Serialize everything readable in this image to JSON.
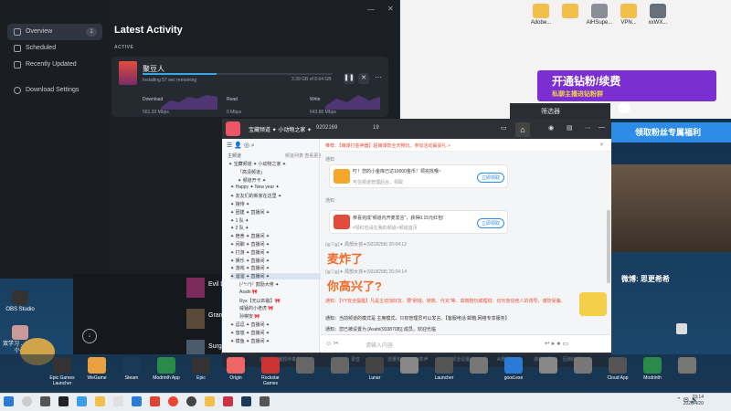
{
  "download_manager": {
    "sidebar": [
      {
        "label": "Overview",
        "badge": "1"
      },
      {
        "label": "Scheduled"
      },
      {
        "label": "Recently Updated"
      },
      {
        "label": "Download Settings"
      }
    ],
    "title": "Latest Activity",
    "section_label": "ACTIVE",
    "item": {
      "name": "聚豆人",
      "status": "Installing 57 sec remaining",
      "size": "3.39 GB of 8.64 GB",
      "progress": 0.39
    },
    "stats": [
      {
        "label": "Download",
        "value": "561.33 Mbps"
      },
      {
        "label": "Read",
        "value": "0 Mbps"
      },
      {
        "label": "Write",
        "value": "643.80 Mbps"
      }
    ],
    "sidebar_extra": [
      "Evil D",
      "Gran",
      "Surg"
    ]
  },
  "desktop": {
    "top_icons": [
      "Adobe...",
      "",
      "AlHSupe...",
      "VPN...",
      "xxWX..."
    ],
    "left_icons": [
      "OBS Studio",
      "双学习 ...MAN 小 ..."
    ],
    "clock_time": "23:14",
    "clock_date": "2026/4/20"
  },
  "dock": {
    "items": [
      "Epic Games Launcher",
      "WeGame",
      "Steam",
      "Modrinth App",
      "Epic",
      "Origin",
      "Rockstar Games",
      "",
      "",
      "Lunar",
      "",
      "Launcher",
      "",
      "good.exe",
      "",
      "",
      "Cloud App",
      "Modrinth",
      ""
    ]
  },
  "overlays": {
    "purple_title": "开通钻粉/续费",
    "purple_sub": "私聊主播进钻粉群",
    "blue_banner": "领取粉丝专属福利",
    "weibo": "微博: 思更希希",
    "dark_panel_label": "筛选器"
  },
  "chat": {
    "channel": "宝藏频道 ✦ 小动物之家 ✦",
    "user_id": "9202169",
    "online": "19",
    "notice": "推荐：【萌爆打金神器】超萌爆款全天畅玩，参加活动赢豪礼 >",
    "left_header": [
      "主频道",
      "频道列表 查看更多"
    ],
    "tree": [
      "✦ 宝藏频道 ✦ 小动物之家 ✦",
      "「高清频道」",
      "✦ 频道开卡 ✦",
      "✦ Happy ✦ New year ✦",
      "✦ 友友们的新家在这里 ✦",
      "✦ 接待 ✦",
      "✦ 团建 ✦ 直播间 ✦",
      "✦ 1 队 ✦",
      "✦ 2 队 ✦",
      "✦ 宿舍 ✦ 直播间 ✦",
      "✦ 闲聊 ✦ 直播间 ✦",
      "✦ 打游 ✦ 直播间 ✦",
      "✦ 娱乐 ✦ 直播间 ✦",
      "✦ 游戏 ✦ 直播间 ✦",
      "✦ 溜溜 ✦ 直播间 ✦",
      "(╯°□°)╯ 鼓励大佬 ✦",
      "Asahi 🎀",
      "Ryx【无以匹敌】🎀",
      "威猛的小老虎 🎀",
      "孙棋安 🎀",
      "✦ 逗逗 ✦ 直播间 ✦",
      "✦ 悠悠 ✦ 直播间 ✦",
      "✦ 摸鱼 ✦ 直播间 ✦"
    ],
    "messages": {
      "sys1": "通知",
      "card1_title": "叮！您的小金库已达10000金币！领完找哦~",
      "card1_sub": "可在频道管理后台，领取",
      "sys2": "通知",
      "card2_title": "恭喜完成“频道内开麦发言”，获得0.15元红包!",
      "card2_sub": "#领红包请在我的频道>频道首页",
      "card_btn": "立即领取",
      "user1": "(≧▽≦)✦ 局部女孩✦(9318258) 20:04:12",
      "big1": "麦炸了",
      "user2": "(≧▽≦)✦ 局部女孩✦(9318258) 20:04:14",
      "big2": "你高兴了?",
      "sys3": "通知：【YY安全提醒】凡是主动加好友、要“刷钱、转账、代充”等、高端陪玩或理财、切勿盲信他人的诱导，谨防受骗。",
      "sys4": "通知：当前频道的模式是 主席模式，只有管理员可以发言。【客服电话 邮箱,网络专享服务】",
      "sys5": "通知：您已被设置为 [Asahi(9338708)] 成员，欢迎光临",
      "input_placeholder": "请输入内容"
    },
    "controls": [
      "自由发言",
      "播放伴奏",
      "变声",
      "录音",
      "流量包",
      "AI变声",
      "频道设置",
      "AI陪唱",
      "游戏空间",
      "回到旧版"
    ]
  }
}
